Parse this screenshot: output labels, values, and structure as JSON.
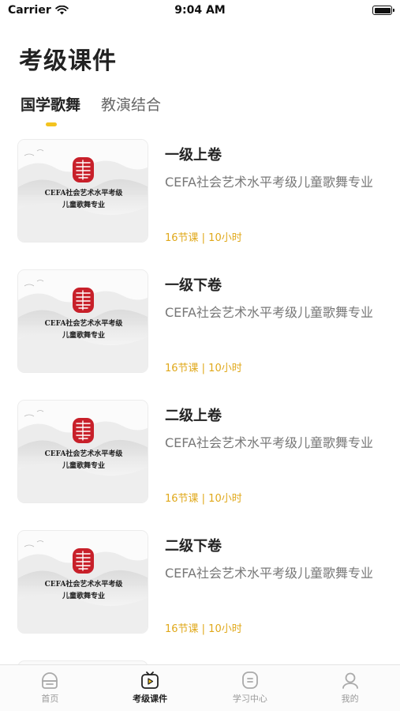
{
  "status_bar": {
    "carrier": "Carrier",
    "time": "9:04 AM"
  },
  "page_title": "考级课件",
  "tabs": [
    {
      "label": "国学歌舞",
      "active": true
    },
    {
      "label": "教演结合",
      "active": false
    }
  ],
  "thumbnail": {
    "line1": "CEFA社会艺术水平考级",
    "line2": "儿童歌舞专业",
    "seal_color": "#c8202a"
  },
  "courses": [
    {
      "title": "一级上卷",
      "desc": "CEFA社会艺术水平考级儿童歌舞专业",
      "meta": "16节课 | 10小时"
    },
    {
      "title": "一级下卷",
      "desc": "CEFA社会艺术水平考级儿童歌舞专业",
      "meta": "16节课 | 10小时"
    },
    {
      "title": "二级上卷",
      "desc": "CEFA社会艺术水平考级儿童歌舞专业",
      "meta": "16节课 | 10小时"
    },
    {
      "title": "二级下卷",
      "desc": "CEFA社会艺术水平考级儿童歌舞专业",
      "meta": "16节课 | 10小时"
    }
  ],
  "tab_bar": [
    {
      "label": "首页",
      "icon": "home-icon",
      "active": false
    },
    {
      "label": "考级课件",
      "icon": "courseware-icon",
      "active": true
    },
    {
      "label": "学习中心",
      "icon": "study-center-icon",
      "active": false
    },
    {
      "label": "我的",
      "icon": "profile-icon",
      "active": false
    }
  ],
  "colors": {
    "accent": "#f3c31f",
    "meta_text": "#e0a81a"
  }
}
